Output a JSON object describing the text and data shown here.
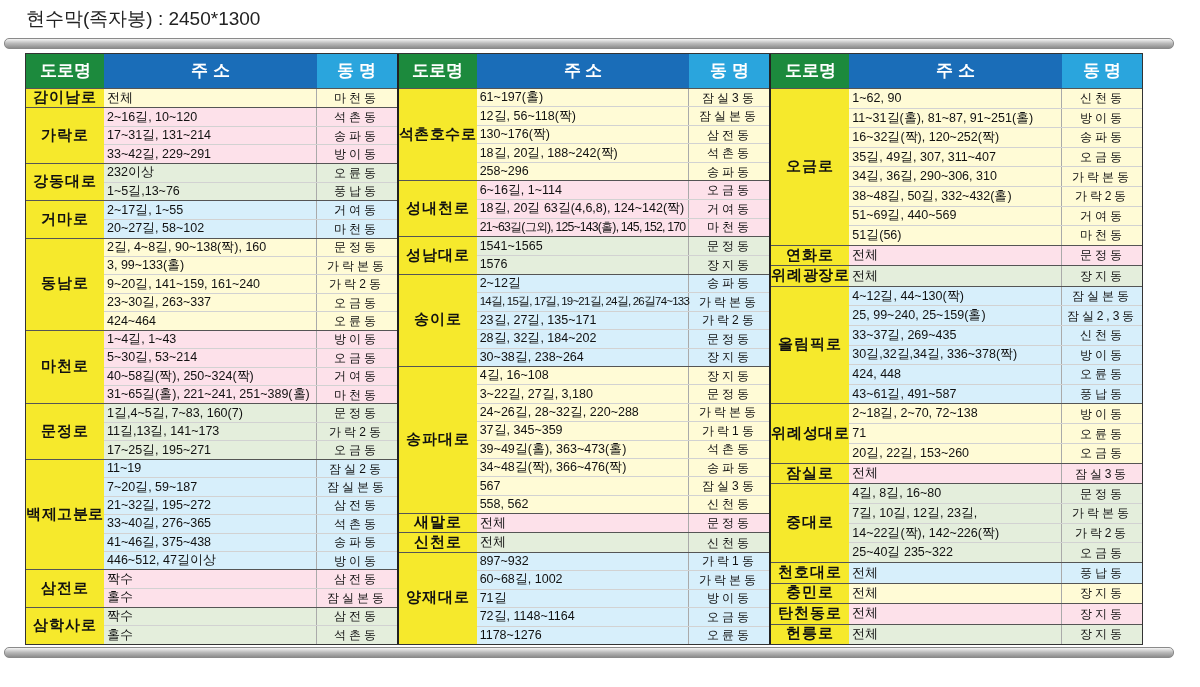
{
  "title": "현수막(족자봉) : 2450*1300",
  "panels": [
    {
      "headers": [
        "도로명",
        "주 소",
        "동 명"
      ],
      "groups": [
        {
          "road": "감이남로",
          "color": "#fffbd6",
          "rows": [
            [
              "전체",
              "마천동"
            ]
          ]
        },
        {
          "road": "가락로",
          "color": "#fde1ea",
          "rows": [
            [
              "2~16길, 10~120",
              "석촌동"
            ],
            [
              "17~31길, 131~214",
              "송파동"
            ],
            [
              "33~42길, 229~291",
              "방이동"
            ]
          ]
        },
        {
          "road": "강동대로",
          "color": "#e4eedc",
          "rows": [
            [
              "232이상",
              "오륜동"
            ],
            [
              "1~5길,13~76",
              "풍납동"
            ]
          ]
        },
        {
          "road": "거마로",
          "color": "#d7effb",
          "rows": [
            [
              "2~17길, 1~55",
              "거여동"
            ],
            [
              "20~27길, 58~102",
              "마천동"
            ]
          ]
        },
        {
          "road": "동남로",
          "color": "#fffbd6",
          "rows": [
            [
              "2길, 4~8길, 90~138(짝), 160",
              "문정동"
            ],
            [
              "3, 99~133(홀)",
              "가락본동"
            ],
            [
              "9~20길, 141~159, 161~240",
              "가락2동"
            ],
            [
              "23~30길, 263~337",
              "오금동"
            ],
            [
              "424~464",
              "오륜동"
            ]
          ]
        },
        {
          "road": "마천로",
          "color": "#fde1ea",
          "rows": [
            [
              "1~4길,  1~43",
              "방이동"
            ],
            [
              "5~30길, 53~214",
              "오금동"
            ],
            [
              "40~58길(짝), 250~324(짝)",
              "거여동"
            ],
            [
              "31~65길(홀), 221~241, 251~389(홀)",
              "마천동"
            ]
          ]
        },
        {
          "road": "문정로",
          "color": "#e4eedc",
          "rows": [
            [
              "1길,4~5길, 7~83, 160(7)",
              "문정동"
            ],
            [
              "11길,13길, 141~173",
              "가락2동"
            ],
            [
              "17~25길, 195~271",
              "오금동"
            ]
          ]
        },
        {
          "road": "백제고분로",
          "color": "#d7effb",
          "rows": [
            [
              "11~19",
              "잠실2동"
            ],
            [
              "7~20길, 59~187",
              "잠실본동"
            ],
            [
              "21~32길, 195~272",
              "삼전동"
            ],
            [
              "33~40길, 276~365",
              "석촌동"
            ],
            [
              "41~46길, 375~438",
              "송파동"
            ],
            [
              "446~512, 47길이상",
              "방이동"
            ]
          ]
        },
        {
          "road": "삼전로",
          "color": "#fde1ea",
          "rows": [
            [
              "짝수",
              "삼전동"
            ],
            [
              "홀수",
              "잠실본동"
            ]
          ]
        },
        {
          "road": "삼학사로",
          "color": "#e4eedc",
          "rows": [
            [
              "짝수",
              "삼전동"
            ],
            [
              "홀수",
              "석촌동"
            ]
          ]
        }
      ]
    },
    {
      "headers": [
        "도로명",
        "주 소",
        "동 명"
      ],
      "groups": [
        {
          "road": "석촌호수로",
          "color": "#fffbd6",
          "rows": [
            [
              "61~197(홀)",
              "잠실3동"
            ],
            [
              "12길, 56~118(짝)",
              "잠실본동"
            ],
            [
              "130~176(짝)",
              "삼전동"
            ],
            [
              "18길, 20길, 188~242(짝)",
              "석촌동"
            ],
            [
              "258~296",
              "송파동"
            ]
          ]
        },
        {
          "road": "성내천로",
          "color": "#fde1ea",
          "rows": [
            [
              "6~16길, 1~114",
              "오금동"
            ],
            [
              "18길, 20길 63길(4,6,8), 124~142(짝)",
              "거여동"
            ],
            [
              "21~63길(그외), 125~143(홀), 145, 152, 170",
              "마천동"
            ]
          ]
        },
        {
          "road": "성남대로",
          "color": "#e4eedc",
          "rows": [
            [
              "1541~1565",
              "문정동"
            ],
            [
              "1576",
              "장지동"
            ]
          ]
        },
        {
          "road": "송이로",
          "color": "#d7effb",
          "rows": [
            [
              "2~12길",
              "송파동"
            ],
            [
              "14길, 15길, 17길, 19~21길, 24길, 26길74~133",
              "가락본동"
            ],
            [
              "23길, 27길, 135~171",
              "가락2동"
            ],
            [
              "28길, 32길, 184~202",
              "문정동"
            ],
            [
              "30~38길, 238~264",
              "장지동"
            ]
          ]
        },
        {
          "road": "송파대로",
          "color": "#fffbd6",
          "rows": [
            [
              "4길, 16~108",
              "장지동"
            ],
            [
              "3~22길, 27길, 3,180",
              "문정동"
            ],
            [
              "24~26길, 28~32길, 220~288",
              "가락본동"
            ],
            [
              "37길, 345~359",
              "가락1동"
            ],
            [
              "39~49길(홀), 363~473(홀)",
              "석촌동"
            ],
            [
              "34~48길(짝), 366~476(짝)",
              "송파동"
            ],
            [
              "567",
              "잠실3동"
            ],
            [
              "558, 562",
              "신천동"
            ]
          ]
        },
        {
          "road": "새말로",
          "color": "#fde1ea",
          "rows": [
            [
              "전체",
              "문정동"
            ]
          ]
        },
        {
          "road": "신천로",
          "color": "#e4eedc",
          "rows": [
            [
              "전체",
              "신천동"
            ]
          ]
        },
        {
          "road": "양재대로",
          "color": "#d7effb",
          "rows": [
            [
              "897~932",
              "가락1동"
            ],
            [
              "60~68길, 1002",
              "가락본동"
            ],
            [
              "71길",
              "방이동"
            ],
            [
              "72길, 1148~1164",
              "오금동"
            ],
            [
              "1178~1276",
              "오륜동"
            ]
          ]
        }
      ]
    },
    {
      "headers": [
        "도로명",
        "주 소",
        "동 명"
      ],
      "groups": [
        {
          "road": "오금로",
          "color": "#fffbd6",
          "rows": [
            [
              "1~62, 90",
              "신천동"
            ],
            [
              "11~31길(홀), 81~87, 91~251(홀)",
              "방이동"
            ],
            [
              "16~32길(짝), 120~252(짝)",
              "송파동"
            ],
            [
              "35길, 49길, 307, 311~407",
              "오금동"
            ],
            [
              "34길, 36길, 290~306, 310",
              "가락본동"
            ],
            [
              "38~48길, 50길, 332~432(홀)",
              "가락2동"
            ],
            [
              "51~69길, 440~569",
              "거여동"
            ],
            [
              "51길(56)",
              "마천동"
            ]
          ]
        },
        {
          "road": "연화로",
          "color": "#fde1ea",
          "rows": [
            [
              "전체",
              "문정동"
            ]
          ]
        },
        {
          "road": "위례광장로",
          "color": "#e4eedc",
          "rows": [
            [
              "전체",
              "장지동"
            ]
          ]
        },
        {
          "road": "올림픽로",
          "color": "#d7effb",
          "rows": [
            [
              "4~12길, 44~130(짝)",
              "잠실본동"
            ],
            [
              "25, 99~240, 25~159(홀)",
              "잠실2,3동"
            ],
            [
              "33~37길, 269~435",
              "신천동"
            ],
            [
              "30길,32길,34길, 336~378(짝)",
              "방이동"
            ],
            [
              "424, 448",
              "오륜동"
            ],
            [
              "43~61길, 491~587",
              "풍납동"
            ]
          ]
        },
        {
          "road": "위례성대로",
          "color": "#fffbd6",
          "rows": [
            [
              "2~18길, 2~70, 72~138",
              "방이동"
            ],
            [
              "71",
              "오륜동"
            ],
            [
              "20길, 22길, 153~260",
              "오금동"
            ]
          ]
        },
        {
          "road": "잠실로",
          "color": "#fde1ea",
          "rows": [
            [
              "전체",
              "잠실3동"
            ]
          ]
        },
        {
          "road": "중대로",
          "color": "#e4eedc",
          "rows": [
            [
              "4길, 8길, 16~80",
              "문정동"
            ],
            [
              "7길, 10길, 12길, 23길,",
              "가락본동"
            ],
            [
              "14~22길(짝), 142~226(짝)",
              "가락2동"
            ],
            [
              "25~40길 235~322",
              "오금동"
            ]
          ]
        },
        {
          "road": "천호대로",
          "color": "#d7effb",
          "rows": [
            [
              "전체",
              "풍납동"
            ]
          ]
        },
        {
          "road": "충민로",
          "color": "#fffbd6",
          "rows": [
            [
              "전체",
              "장지동"
            ]
          ]
        },
        {
          "road": "탄천동로",
          "color": "#fde1ea",
          "rows": [
            [
              "전체",
              "장지동"
            ]
          ]
        },
        {
          "road": "헌릉로",
          "color": "#e4eedc",
          "rows": [
            [
              "전체",
              "장지동"
            ]
          ]
        }
      ]
    }
  ]
}
